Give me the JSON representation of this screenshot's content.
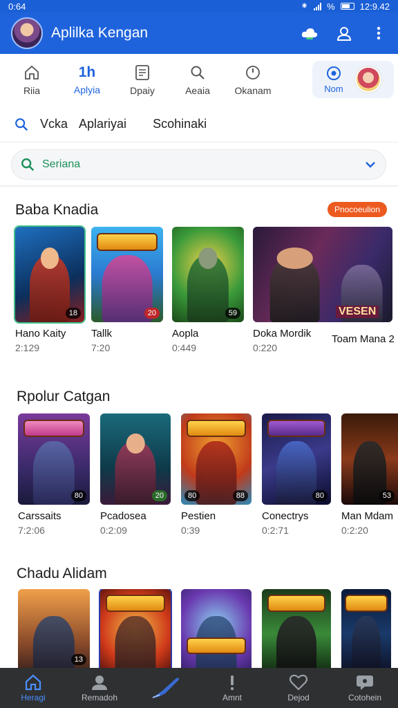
{
  "status_bar": {
    "time": "0:64",
    "battery": "%",
    "clock": "12:9.42"
  },
  "app_bar": {
    "title": "Aplilka Kengan",
    "actions": [
      "cloud-icon",
      "profile-icon",
      "more-vert-icon"
    ]
  },
  "categories": {
    "tabs": [
      {
        "label": "Riia",
        "icon": "home-icon"
      },
      {
        "label": "Aplyia",
        "icon_text": "1h",
        "active": true
      },
      {
        "label": "Dpaiy",
        "icon": "document-icon"
      },
      {
        "label": "Aeaia",
        "icon": "search-icon"
      },
      {
        "label": "Okanam",
        "icon": "clock-icon"
      }
    ],
    "now_tab": {
      "label": "Nom",
      "icon": "radio-icon"
    }
  },
  "filters": {
    "items": [
      "Vcka",
      "Aplariyai",
      "Scohinaki"
    ]
  },
  "search": {
    "value": "Seriana"
  },
  "sections": [
    {
      "title": "Baba Knadia",
      "badge": "Pnocoeulion",
      "cards": [
        {
          "title": "Hano Kaity",
          "meta": "2:129",
          "duration": "18"
        },
        {
          "title": "Tallk",
          "meta": "7:20",
          "duration": "20"
        },
        {
          "title": "Aopla",
          "meta": "0:449",
          "duration": "59"
        },
        {
          "title": "Doka Mordik",
          "meta": "0:220",
          "banner": "VESEN"
        },
        {
          "title": "Toam Mana 2",
          "meta": ""
        }
      ]
    },
    {
      "title": "Rpolur Catgan",
      "cards": [
        {
          "title": "Carssaits",
          "meta": "7:2:06",
          "duration": "80"
        },
        {
          "title": "Pcadosea",
          "meta": "0:2:09",
          "duration": "20"
        },
        {
          "title": "Pestien",
          "meta": "0:39",
          "duration": "80",
          "duration2": "88"
        },
        {
          "title": "Conectrys",
          "meta": "0:2:71",
          "duration": "80"
        },
        {
          "title": "Man Mdam",
          "meta": "0:2:20",
          "duration": "53"
        }
      ]
    },
    {
      "title": "Chadu Alidam",
      "cards": [
        {
          "title": "",
          "duration": "13"
        },
        {
          "title": ""
        },
        {
          "title": ""
        },
        {
          "title": ""
        },
        {
          "title": ""
        }
      ]
    }
  ],
  "bottom_nav": [
    {
      "label": "Heragi",
      "icon": "home-icon",
      "active": true
    },
    {
      "label": "Remadoh",
      "icon": "person-icon"
    },
    {
      "label": "",
      "icon": "pen-icon"
    },
    {
      "label": "Amnt",
      "icon": "alert-icon"
    },
    {
      "label": "Dejod",
      "icon": "heart-icon"
    },
    {
      "label": "Cotohein",
      "icon": "chat-icon"
    }
  ],
  "colors": {
    "primary": "#1f63dc",
    "badge": "#ec5a1f",
    "search_text": "#1c8f5a",
    "nav_bg": "#2e3032"
  }
}
